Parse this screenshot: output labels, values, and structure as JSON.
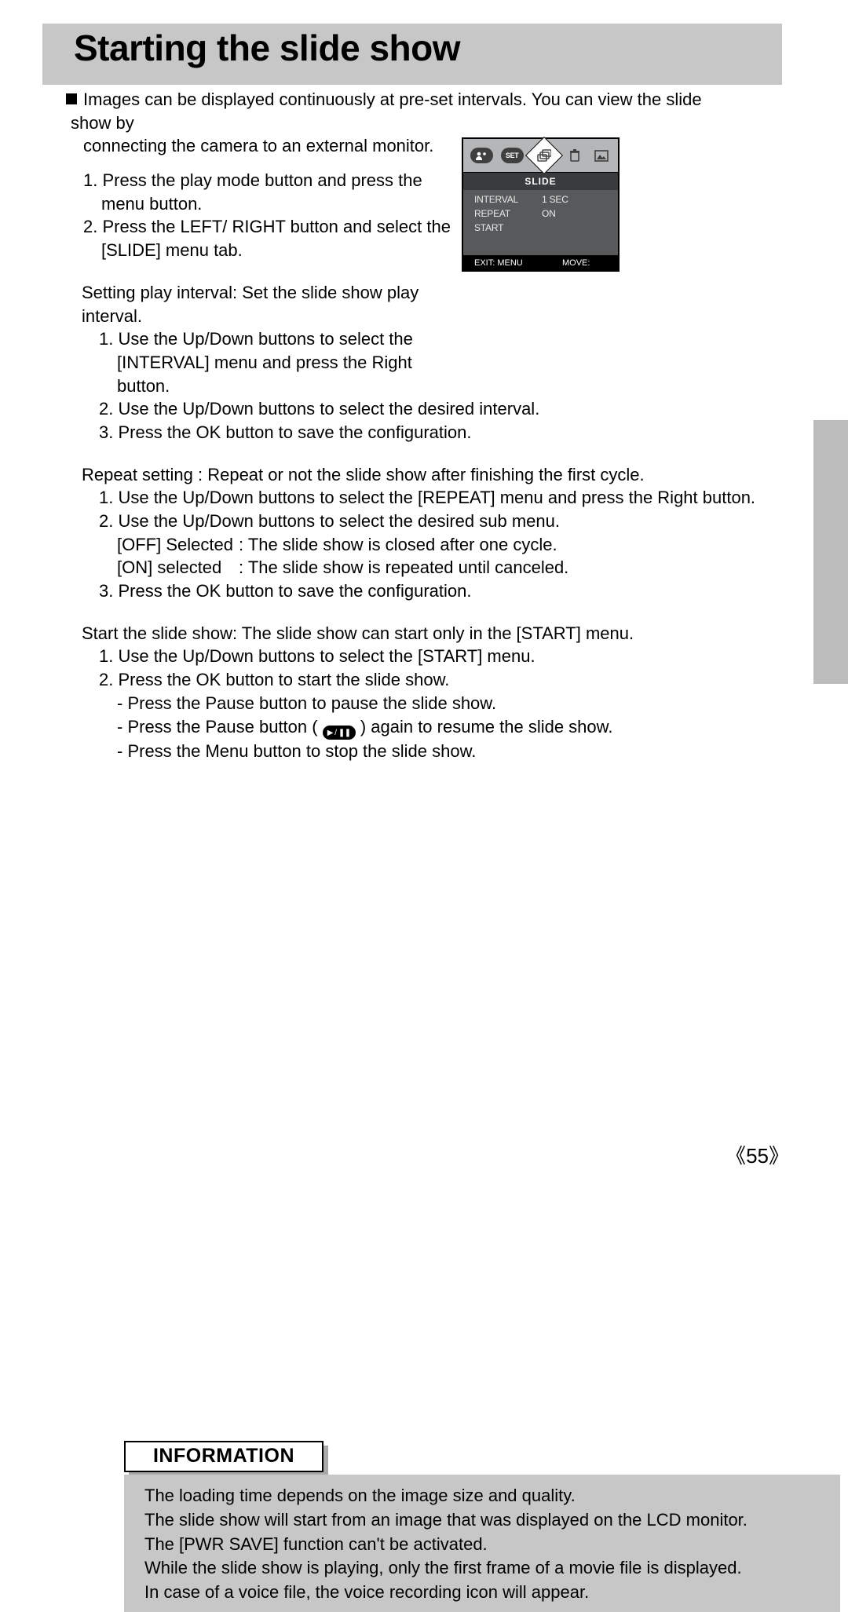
{
  "title": "Starting the slide show",
  "intro_line1": "Images can be displayed continuously at pre-set intervals. You can view the slide show by",
  "intro_line2": "connecting the camera to an external monitor.",
  "steps_top": [
    "1. Press the play mode button and press the menu button.",
    "2. Press the LEFT/ RIGHT button and select the [SLIDE] menu tab."
  ],
  "interval": {
    "heading": "Setting play interval: Set the slide show play interval.",
    "items": [
      "1. Use the Up/Down buttons to select the [INTERVAL] menu and press the Right button.",
      "2. Use the Up/Down buttons to select the desired interval.",
      "3. Press the OK button to save the configuration."
    ]
  },
  "repeat": {
    "heading": "Repeat setting : Repeat or not the slide show after finishing the first cycle.",
    "items": [
      "1. Use the Up/Down buttons to select the [REPEAT] menu and press the Right button.",
      "2. Use the Up/Down buttons to select the desired sub menu."
    ],
    "off_label": "[OFF] Selected",
    "off_desc": ": The slide show is closed after one cycle.",
    "on_label": "[ON] selected",
    "on_desc": ": The slide show is repeated until canceled.",
    "item3": "3. Press the OK button to save the configuration."
  },
  "start": {
    "heading": "Start the slide show: The slide show can start only in the [START] menu.",
    "items": [
      "1. Use the Up/Down buttons to select the [START] menu.",
      "2. Press the OK button to start the slide show."
    ],
    "sub": [
      "- Press the Pause button to pause the slide show.",
      "- Press the Pause button (             ) again to resume the slide show.",
      "- Press the Menu button to stop the slide show."
    ],
    "pause_pre": "- Press the Pause button (  ",
    "pause_post": "  ) again to resume the slide show."
  },
  "info": {
    "header": "INFORMATION",
    "lines": [
      "The loading time depends on the image size and quality.",
      "The slide show will start from an image that was displayed on the LCD monitor.",
      "The [PWR SAVE] function can't be activated.",
      "While the slide show is playing, only the first frame of a movie file is displayed.",
      "In case of a voice file, the voice recording icon will appear."
    ]
  },
  "panel": {
    "tabs": {
      "set": "SET"
    },
    "title": "SLIDE",
    "rows": [
      {
        "label": "INTERVAL",
        "value": "1 SEC"
      },
      {
        "label": "REPEAT",
        "value": "ON"
      },
      {
        "label": "START",
        "value": ""
      }
    ],
    "footer_left": "EXIT: MENU",
    "footer_right": "MOVE:"
  },
  "page_number": "55"
}
